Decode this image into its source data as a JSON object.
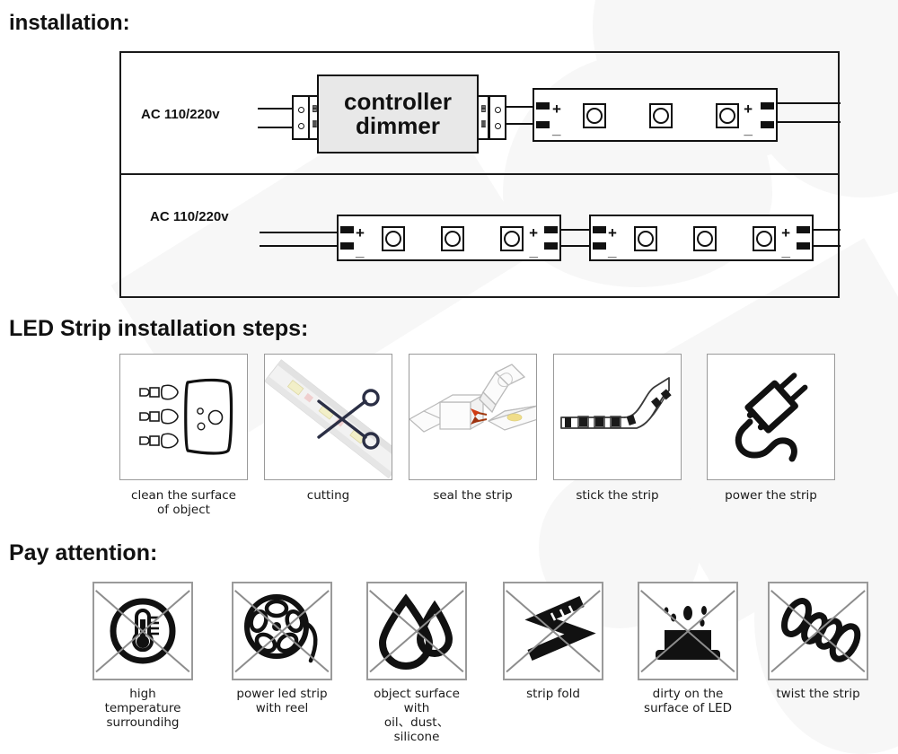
{
  "headings": {
    "installation": "installation:",
    "steps": "LED Strip installation steps:",
    "attention": "Pay attention:"
  },
  "diagram": {
    "row1": {
      "ac_label": "AC 110/220v",
      "controller_line1": "controller",
      "controller_line2": "dimmer",
      "strip_left_plus": "+",
      "strip_left_minus": "_",
      "strip_right_plus": "+",
      "strip_right_minus": "_",
      "led_count": 3
    },
    "row2": {
      "ac_label": "AC 110/220v",
      "strip1_left_plus": "+",
      "strip1_left_minus": "_",
      "strip1_right_plus": "+",
      "strip1_right_minus": "_",
      "strip2_left_plus": "+",
      "strip2_left_minus": "_",
      "strip2_right_plus": "+",
      "strip2_right_minus": "_",
      "led_count": 3
    }
  },
  "steps": [
    {
      "icon": "clean-surface-icon",
      "label": "clean the surface\nof object"
    },
    {
      "icon": "scissors-cutting-icon",
      "label": "cutting"
    },
    {
      "icon": "seal-strip-glue-icon",
      "label": "seal the strip"
    },
    {
      "icon": "stick-strip-icon",
      "label": "stick the strip"
    },
    {
      "icon": "power-plug-icon",
      "label": "power the strip"
    }
  ],
  "warnings": [
    {
      "icon": "thermometer-icon",
      "label": "high temperature\nsurroundihg"
    },
    {
      "icon": "reel-icon",
      "label": "power led strip\nwith reel"
    },
    {
      "icon": "water-droplet-icon",
      "label": "object surface with\noil、dust、silicone"
    },
    {
      "icon": "folded-strip-icon",
      "label": "strip fold"
    },
    {
      "icon": "dirty-led-icon",
      "label": "dirty on the\nsurface of LED"
    },
    {
      "icon": "twisted-strip-icon",
      "label": "twist the strip"
    }
  ],
  "colors": {
    "ink": "#111111",
    "controller_fill": "#e8e8e8",
    "card_border": "#9a9a9a",
    "x_stroke": "#8d8d8d",
    "watermark": "#f7f7f7"
  }
}
